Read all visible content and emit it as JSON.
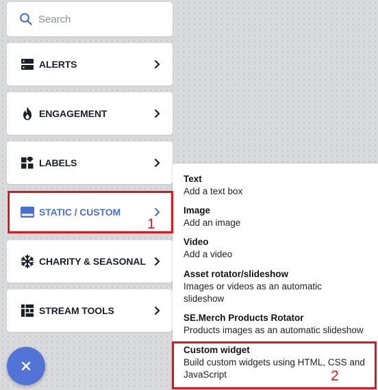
{
  "search": {
    "placeholder": "Search",
    "icon": "search-icon"
  },
  "sidebar": {
    "items": [
      {
        "label": "ALERTS",
        "icon": "alerts-icon"
      },
      {
        "label": "ENGAGEMENT",
        "icon": "flame-icon"
      },
      {
        "label": "LABELS",
        "icon": "labels-icon"
      },
      {
        "label": "STATIC / CUSTOM",
        "icon": "static-custom-icon",
        "active": true
      },
      {
        "label": "CHARITY & SEASONAL",
        "icon": "snowflake-icon"
      },
      {
        "label": "STREAM TOOLS",
        "icon": "stream-tools-icon"
      }
    ]
  },
  "fab": {
    "icon": "close-icon"
  },
  "popup": {
    "items": [
      {
        "title": "Text",
        "description": "Add a text box"
      },
      {
        "title": "Image",
        "description": "Add an image"
      },
      {
        "title": "Video",
        "description": "Add a video"
      },
      {
        "title": "Asset rotator/slideshow",
        "description": "Images or videos as an automatic slideshow"
      },
      {
        "title": "SE.Merch Products Rotator",
        "description": "Products images as an automatic slideshow"
      },
      {
        "title": "Custom widget",
        "description": "Build custom widgets using HTML, CSS and JavaScript"
      }
    ]
  },
  "annotations": {
    "marker_1": "1",
    "marker_2": "2"
  },
  "colors": {
    "accent": "#5274d6",
    "active_text": "#4b6fd1",
    "highlight": "#e1141c",
    "text_dark": "#1a1f29"
  }
}
